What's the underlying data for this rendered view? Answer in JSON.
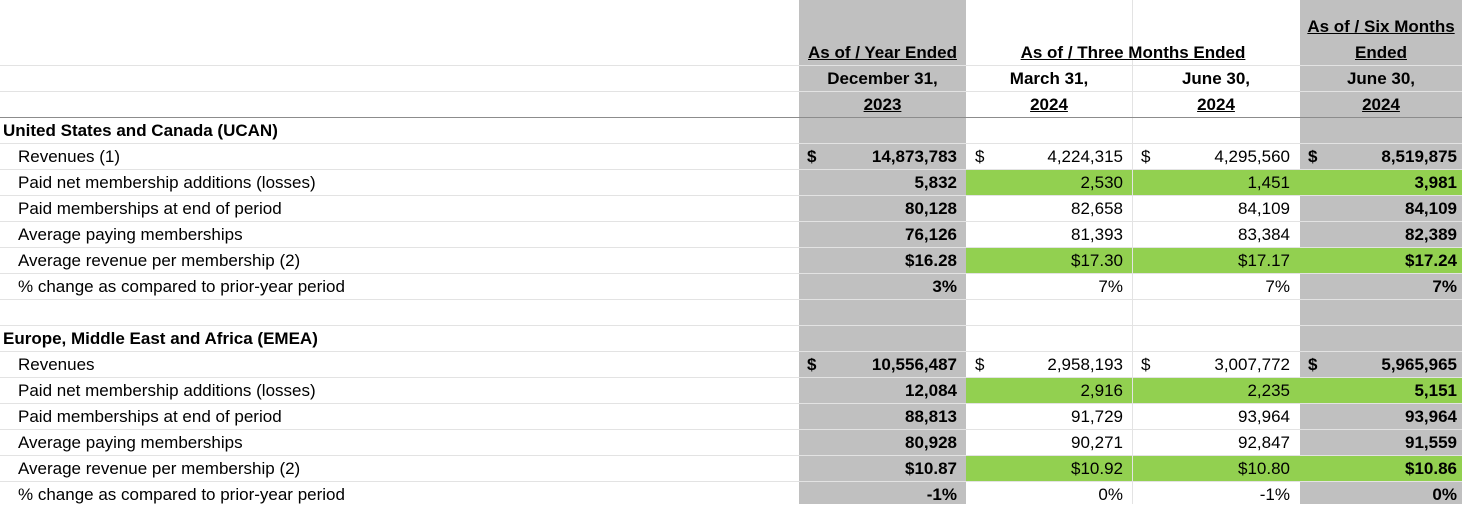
{
  "header": {
    "col1": {
      "line1": "As of / Year Ended",
      "line2": "December 31,",
      "line3": "2023"
    },
    "group": {
      "title": "As of / Three Months Ended"
    },
    "col2": {
      "line2": "March 31,",
      "line3": "2024"
    },
    "col3": {
      "line2": "June 30,",
      "line3": "2024"
    },
    "col4": {
      "line0": "As of / Six Months",
      "line1": "Ended",
      "line2": "June 30,",
      "line3": "2024"
    }
  },
  "sections": [
    {
      "title": "United States and Canada (UCAN)",
      "rows": [
        {
          "label": "Revenues (1)",
          "values": [
            "14,873,783",
            "4,224,315",
            "4,295,560",
            "8,519,875"
          ],
          "currency": "$"
        },
        {
          "label": "Paid net membership additions (losses)",
          "values": [
            "5,832",
            "2,530",
            "1,451",
            "3,981"
          ]
        },
        {
          "label": "Paid memberships at end of period",
          "values": [
            "80,128",
            "82,658",
            "84,109",
            "84,109"
          ]
        },
        {
          "label": "Average paying memberships",
          "values": [
            "76,126",
            "81,393",
            "83,384",
            "82,389"
          ]
        },
        {
          "label": "Average revenue per membership (2)",
          "values": [
            "$16.28",
            "$17.30",
            "$17.17",
            "$17.24"
          ]
        },
        {
          "label": "% change as compared to prior-year period",
          "values": [
            "3%",
            "7%",
            "7%",
            "7%"
          ]
        }
      ]
    },
    {
      "title": "Europe, Middle East and Africa (EMEA)",
      "rows": [
        {
          "label": "Revenues",
          "values": [
            "10,556,487",
            "2,958,193",
            "3,007,772",
            "5,965,965"
          ],
          "currency": "$"
        },
        {
          "label": "Paid net membership additions (losses)",
          "values": [
            "12,084",
            "2,916",
            "2,235",
            "5,151"
          ]
        },
        {
          "label": "Paid memberships at end of period",
          "values": [
            "88,813",
            "91,729",
            "93,964",
            "93,964"
          ]
        },
        {
          "label": "Average paying memberships",
          "values": [
            "80,928",
            "90,271",
            "92,847",
            "91,559"
          ]
        },
        {
          "label": "Average revenue per membership (2)",
          "values": [
            "$10.87",
            "$10.92",
            "$10.80",
            "$10.86"
          ]
        },
        {
          "label": "% change as compared to prior-year period",
          "values": [
            "-1%",
            "0%",
            "-1%",
            "0%"
          ]
        }
      ]
    }
  ],
  "colors": {
    "gray_column": "#c0c0c0",
    "highlight_green": "#92d050"
  }
}
